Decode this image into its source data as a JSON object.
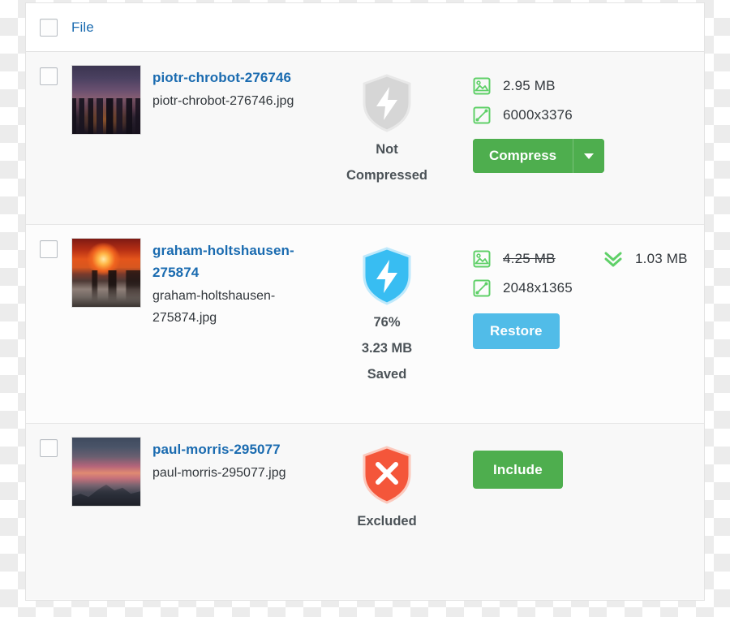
{
  "panel": {
    "header": {
      "select_all_checkbox": "unchecked",
      "column_label": "File"
    },
    "accent_colors": {
      "link_blue": "#1a6bb0",
      "green_button": "#4eae4e",
      "blue_button": "#51bce8",
      "shield_compressed": "#38bdf2",
      "shield_not_compressed": "#d4d4d4",
      "shield_excluded": "#f4563a",
      "icon_green": "#5fd068"
    },
    "rows": [
      {
        "checkbox": "unchecked",
        "thumbnail": "city-skyline-dusk",
        "title": "piotr-chrobot-276746",
        "filename": "piotr-chrobot-276746.jpg",
        "status": {
          "icon": "shield-bolt-gray-icon",
          "lines": [
            "Not",
            "Compressed"
          ]
        },
        "meta": [
          {
            "icon": "image-size-icon",
            "value": "2.95 MB",
            "struck": false
          },
          {
            "icon": "dimensions-icon",
            "value": "6000x3376",
            "struck": false
          }
        ],
        "saved": null,
        "action": {
          "type": "split-button",
          "label": "Compress",
          "caret_icon": "chevron-down-icon"
        }
      },
      {
        "checkbox": "unchecked",
        "thumbnail": "beach-sunset",
        "title": "graham-holtshausen-275874",
        "filename": "graham-holtshausen-275874.jpg",
        "status": {
          "icon": "shield-bolt-blue-icon",
          "lines": [
            "76%",
            "3.23 MB",
            "Saved"
          ]
        },
        "meta": [
          {
            "icon": "image-size-icon",
            "value": "4.25 MB",
            "struck": true
          },
          {
            "icon": "dimensions-icon",
            "value": "2048x1365",
            "struck": false
          }
        ],
        "saved": {
          "icon": "double-chevron-down-icon",
          "value": "1.03 MB"
        },
        "action": {
          "type": "button",
          "label": "Restore"
        }
      },
      {
        "checkbox": "unchecked",
        "thumbnail": "mountain-dusk",
        "title": "paul-morris-295077",
        "filename": "paul-morris-295077.jpg",
        "status": {
          "icon": "shield-x-red-icon",
          "lines": [
            "Excluded"
          ]
        },
        "meta": [],
        "saved": null,
        "action": {
          "type": "button",
          "label": "Include"
        }
      }
    ]
  }
}
